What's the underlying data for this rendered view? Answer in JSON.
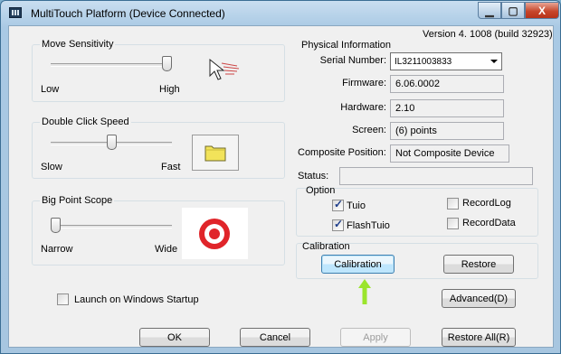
{
  "window": {
    "title": "MultiTouch Platform (Device Connected)",
    "min_glyph": "▁",
    "max_glyph": "▢",
    "close_glyph": "X"
  },
  "version": "Version 4. 1008 (build 32923)",
  "move_sensitivity": {
    "label": "Move Sensitivity",
    "min_label": "Low",
    "max_label": "High",
    "value_pct": 100
  },
  "double_click": {
    "label": "Double Click Speed",
    "min_label": "Slow",
    "max_label": "Fast",
    "value_pct": 50
  },
  "big_point": {
    "label": "Big Point Scope",
    "min_label": "Narrow",
    "max_label": "Wide",
    "value_pct": 0
  },
  "physical": {
    "label": "Physical Information",
    "serial_label": "Serial Number:",
    "serial_value": "IL3211003833",
    "firmware_label": "Firmware:",
    "firmware_value": "6.06.0002",
    "hardware_label": "Hardware:",
    "hardware_value": "2.10",
    "screen_label": "Screen:",
    "screen_value": "(6) points",
    "composite_label": "Composite Position:",
    "composite_value": "Not Composite Device",
    "status_label": "Status:",
    "status_value": ""
  },
  "option": {
    "label": "Option",
    "tuio": {
      "label": "Tuio",
      "checked": true
    },
    "flashtuio": {
      "label": "FlashTuio",
      "checked": true
    },
    "recordlog": {
      "label": "RecordLog",
      "checked": false
    },
    "recorddata": {
      "label": "RecordData",
      "checked": false
    }
  },
  "calibration": {
    "label": "Calibration",
    "calibration_button": "Calibration",
    "restore_button": "Restore"
  },
  "startup": {
    "label": "Launch on Windows Startup",
    "checked": false
  },
  "buttons": {
    "advanced": "Advanced(D)",
    "ok": "OK",
    "cancel": "Cancel",
    "apply": "Apply",
    "restore_all": "Restore All(R)"
  },
  "colors": {
    "accent_arrow": "#9be52c",
    "target_red": "#e0252a",
    "folder_yellow": "#f2e35a"
  }
}
